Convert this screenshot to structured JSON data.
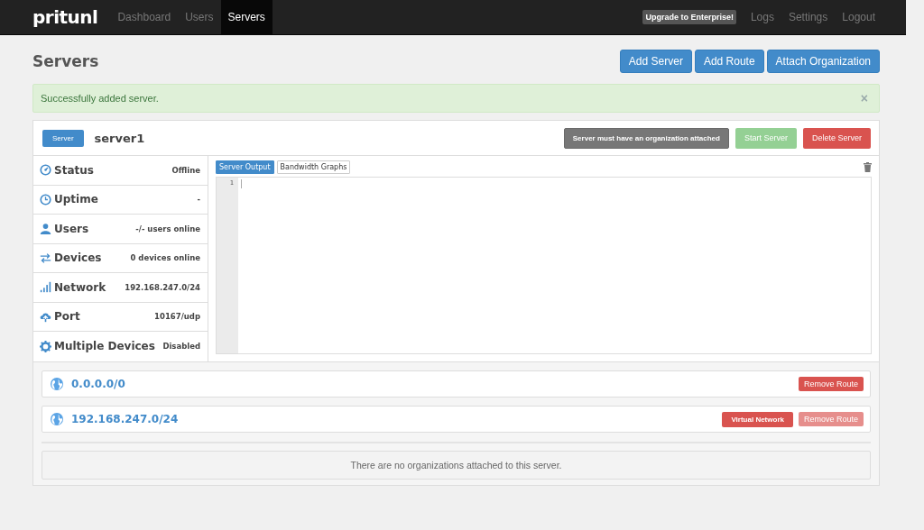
{
  "navbar": {
    "logo": "pritunl",
    "items": [
      {
        "label": "Dashboard",
        "selected": false
      },
      {
        "label": "Users",
        "selected": false
      },
      {
        "label": "Servers",
        "selected": true
      }
    ],
    "upgrade": "Upgrade to Enterprise!",
    "links": [
      "Logs",
      "Settings",
      "Logout"
    ]
  },
  "page": {
    "title": "Servers",
    "buttons": [
      "Add Server",
      "Add Route",
      "Attach Organization"
    ]
  },
  "alert": {
    "message": "Successfully added server.",
    "close": "×"
  },
  "server": {
    "badge": "Server",
    "name": "server1",
    "actions": [
      {
        "label": "Server must have an organization attached",
        "kind": "notice"
      },
      {
        "label": "Start Server",
        "kind": "success",
        "disabled": true
      },
      {
        "label": "Delete Server",
        "kind": "danger",
        "disabled": false
      }
    ],
    "stats": [
      {
        "label": "Status",
        "value": "Offline"
      },
      {
        "label": "Uptime",
        "value": "-"
      },
      {
        "label": "Users",
        "value": "-/- users online"
      },
      {
        "label": "Devices",
        "value": "0 devices online"
      },
      {
        "label": "Network",
        "value": "192.168.247.0/24"
      },
      {
        "label": "Port",
        "value": "10167/udp"
      },
      {
        "label": "Multiple Devices",
        "value": "Disabled"
      }
    ],
    "tabs": [
      {
        "label": "Server Output",
        "selected": true
      },
      {
        "label": "Bandwidth Graphs",
        "selected": false
      }
    ],
    "output": {
      "line_numbers": [
        "1"
      ]
    },
    "routes": [
      {
        "network": "0.0.0.0/0",
        "remove": {
          "label": "Remove Route",
          "disabled": false
        }
      },
      {
        "network": "192.168.247.0/24",
        "tags": [
          "Virtual Network"
        ],
        "remove": {
          "label": "Remove Route",
          "disabled": true
        }
      }
    ],
    "organizations_empty": "There are no organizations attached to this server."
  }
}
